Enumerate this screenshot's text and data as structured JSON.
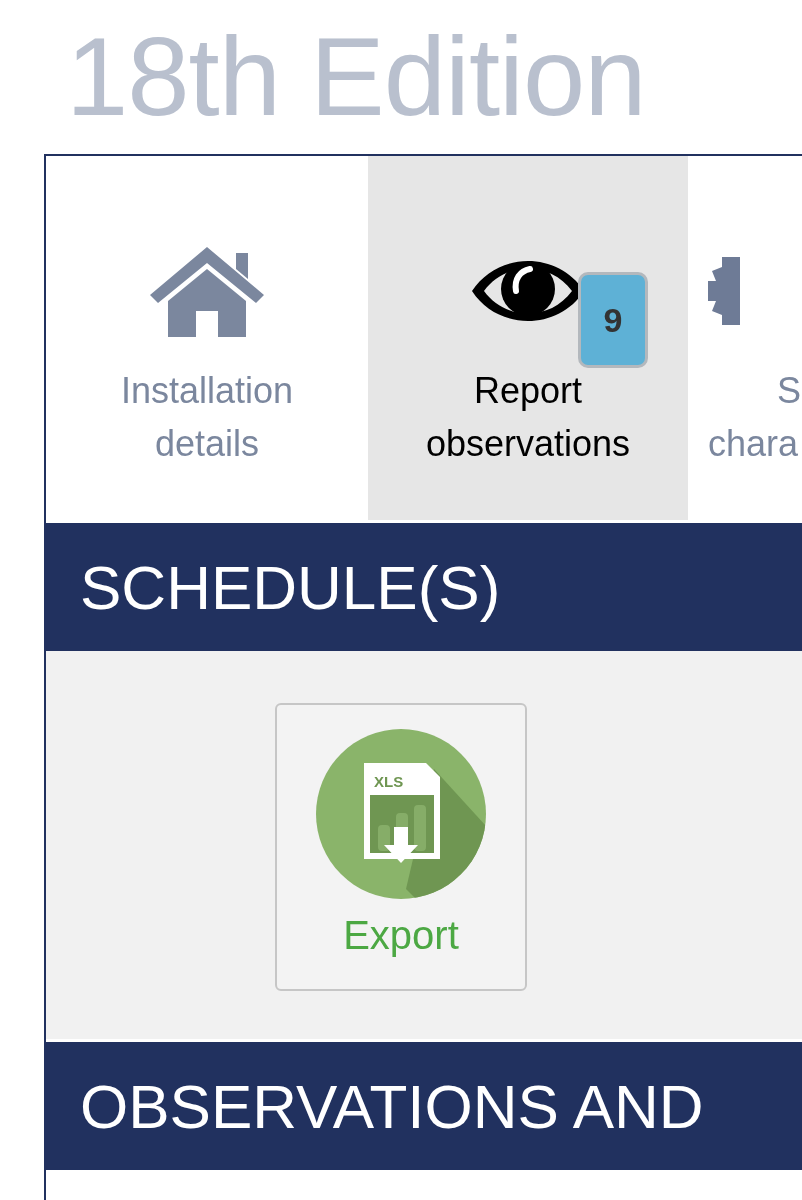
{
  "title": "18th Edition",
  "tabs": [
    {
      "kind": "house",
      "label_lines": [
        "Installation",
        "details"
      ],
      "selected": false
    },
    {
      "kind": "eye",
      "label_lines": [
        "Report",
        "observations"
      ],
      "selected": true,
      "badge": "9"
    },
    {
      "kind": "gear",
      "label_lines": [
        "S",
        "chara"
      ],
      "selected": false
    }
  ],
  "sections": [
    {
      "heading": "SCHEDULE(S)",
      "buttons": [
        {
          "kind": "xls",
          "icon_text": "XLS",
          "label": "Export"
        }
      ]
    },
    {
      "heading": "OBSERVATIONS AND"
    }
  ]
}
